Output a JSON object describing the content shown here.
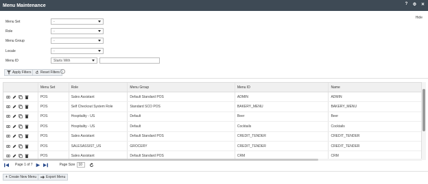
{
  "window": {
    "title": "Menu Maintenance",
    "help": "?",
    "settings": "⚙",
    "close": "✕"
  },
  "filters": {
    "hide_label": "Hide",
    "menu_set": {
      "label": "Menu Set",
      "value": "-"
    },
    "role": {
      "label": "Role",
      "value": "-"
    },
    "menu_group": {
      "label": "Menu Group",
      "value": "-"
    },
    "locale": {
      "label": "Locale",
      "value": "-"
    },
    "menu_id": {
      "label": "Menu ID",
      "mode": "Starts With",
      "value": ""
    },
    "apply_label": "Apply Filters",
    "reset_label": "Reset Filters",
    "info": "i"
  },
  "table": {
    "columns": [
      "Menu Set",
      "Role",
      "Menu Group",
      "Menu ID",
      "Name"
    ],
    "rows": [
      [
        "POS",
        "Sales Assistant",
        "Default Standard POS",
        "ADMIN",
        "ADMIN"
      ],
      [
        "POS",
        "Self Checkout System Role",
        "Standard SCO POS",
        "BAKERY_MENU",
        "BAKERY_MENU"
      ],
      [
        "POS",
        "Hospitality - US",
        "Default",
        "Beer",
        "Beer"
      ],
      [
        "POS",
        "Hospitality - US",
        "Default",
        "Cocktails",
        "Cocktails"
      ],
      [
        "POS",
        "Sales Assistant",
        "Default Standard POS",
        "CREDIT_TENDER",
        "CREDIT_TENDER"
      ],
      [
        "POS",
        "SALESASSIST_US",
        "GROCERY",
        "CREDIT_TENDER",
        "CREDIT_TENDER"
      ],
      [
        "POS",
        "Sales Assistant",
        "Default Standard POS",
        "CRM",
        "CRM"
      ]
    ]
  },
  "pager": {
    "page_text": "Page 1 of 7",
    "page_size_label": "Page Size",
    "page_size": "10"
  },
  "actions": {
    "create_label": "Create New Menu",
    "export_label": "Export Menu"
  }
}
